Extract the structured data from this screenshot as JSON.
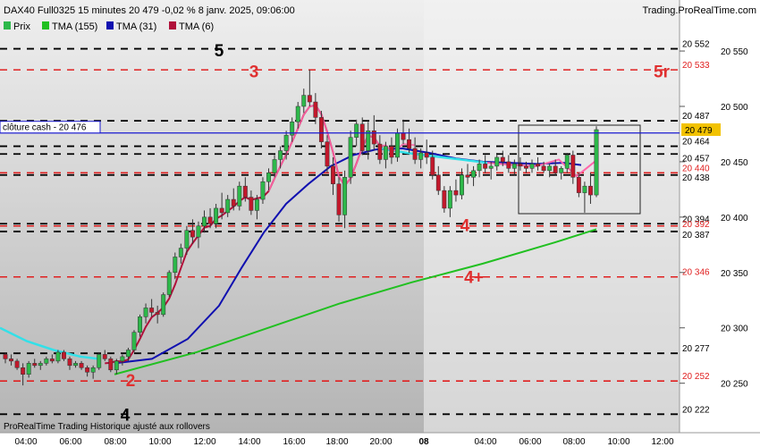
{
  "header": {
    "title": "DAX40 Full0325 15 minutes 20 479 -0,02 % 8 janv. 2025, 09:06:00",
    "site": "Trading.ProRealTime.com"
  },
  "legend": [
    {
      "label": "Prix",
      "color": "#2db84a"
    },
    {
      "label": "TMA (155)",
      "color": "#21c021"
    },
    {
      "label": "TMA (31)",
      "color": "#1010b0"
    },
    {
      "label": "TMA (6)",
      "color": "#b0103a"
    }
  ],
  "footer": "ProRealTime Trading  Historique ajusté aux rollovers",
  "cash_close": {
    "label": "clôture cash -  20 476",
    "value": 20476,
    "color": "#1a1ad0"
  },
  "last_price": {
    "label": "20 479",
    "value": 20479,
    "color": "#f2c200"
  },
  "colors": {
    "up": "#2db84a",
    "down": "#c2182b",
    "black_level": "#000000",
    "red_level": "#e02020",
    "cyan_tma": "#33e0e8",
    "pink_tma": "#ff66aa"
  },
  "chart_data": {
    "type": "candlestick",
    "ylim": [
      20215,
      20567
    ],
    "y_ticks": [
      20250,
      20300,
      20350,
      20400,
      20450,
      20500,
      20550
    ],
    "y_tick_labels": [
      "20 250",
      "20 300",
      "20 350",
      "20 400",
      "20 450",
      "20 500",
      "20 550"
    ],
    "x_tick_labels": [
      "04:00",
      "06:00",
      "08:00",
      "10:00",
      "12:00",
      "14:00",
      "16:00",
      "18:00",
      "20:00",
      "08",
      "04:00",
      "06:00",
      "08:00",
      "10:00",
      "12:00"
    ],
    "levels": [
      {
        "value": 20552,
        "label": "20 552",
        "style": "black"
      },
      {
        "value": 20533,
        "label": "20 533",
        "style": "red"
      },
      {
        "value": 20487,
        "label": "20 487",
        "style": "black"
      },
      {
        "value": 20464,
        "label": "20 464",
        "style": "black"
      },
      {
        "value": 20457,
        "label": "20 457",
        "style": "black"
      },
      {
        "value": 20440,
        "label": "20 440",
        "style": "red"
      },
      {
        "value": 20438,
        "label": "20 438",
        "style": "black"
      },
      {
        "value": 20394,
        "label": "20 394",
        "style": "black"
      },
      {
        "value": 20392,
        "label": "20 392",
        "style": "red"
      },
      {
        "value": 20387,
        "label": "20 387",
        "style": "black"
      },
      {
        "value": 20346,
        "label": "20 346",
        "style": "red"
      },
      {
        "value": 20277,
        "label": "20 277",
        "style": "black"
      },
      {
        "value": 20252,
        "label": "20 252",
        "style": "red"
      },
      {
        "value": 20222,
        "label": "20 222",
        "style": "black"
      }
    ],
    "wave_labels": [
      {
        "text": "5",
        "value": 20551,
        "color": "#000000"
      },
      {
        "text": "3",
        "value": 20532,
        "color": "#e03030"
      },
      {
        "text": "5r",
        "value": 20532,
        "color": "#e03030"
      },
      {
        "text": "4",
        "value": 20393,
        "color": "#e03030"
      },
      {
        "text": "4+",
        "value": 20346,
        "color": "#e03030"
      },
      {
        "text": "2",
        "value": 20253,
        "color": "#e03030"
      },
      {
        "text": "4",
        "value": 20222,
        "color": "#000000"
      }
    ],
    "candles": [
      [
        20276,
        20278,
        20268,
        20272
      ],
      [
        20272,
        20276,
        20266,
        20270
      ],
      [
        20270,
        20272,
        20262,
        20264
      ],
      [
        20264,
        20268,
        20248,
        20258
      ],
      [
        20258,
        20270,
        20255,
        20268
      ],
      [
        20268,
        20272,
        20264,
        20266
      ],
      [
        20266,
        20270,
        20262,
        20268
      ],
      [
        20268,
        20274,
        20266,
        20272
      ],
      [
        20272,
        20276,
        20268,
        20270
      ],
      [
        20270,
        20280,
        20268,
        20278
      ],
      [
        20278,
        20280,
        20270,
        20272
      ],
      [
        20272,
        20274,
        20262,
        20266
      ],
      [
        20266,
        20270,
        20264,
        20268
      ],
      [
        20268,
        20270,
        20262,
        20264
      ],
      [
        20264,
        20266,
        20256,
        20260
      ],
      [
        20260,
        20266,
        20254,
        20264
      ],
      [
        20264,
        20278,
        20262,
        20276
      ],
      [
        20276,
        20280,
        20270,
        20272
      ],
      [
        20272,
        20274,
        20260,
        20262
      ],
      [
        20262,
        20272,
        20258,
        20270
      ],
      [
        20270,
        20276,
        20266,
        20274
      ],
      [
        20274,
        20282,
        20270,
        20280
      ],
      [
        20280,
        20298,
        20278,
        20296
      ],
      [
        20296,
        20312,
        20292,
        20310
      ],
      [
        20310,
        20322,
        20304,
        20318
      ],
      [
        20318,
        20326,
        20310,
        20314
      ],
      [
        20314,
        20320,
        20304,
        20312
      ],
      [
        20312,
        20332,
        20310,
        20330
      ],
      [
        20330,
        20352,
        20328,
        20350
      ],
      [
        20350,
        20368,
        20344,
        20364
      ],
      [
        20364,
        20376,
        20358,
        20372
      ],
      [
        20372,
        20392,
        20366,
        20388
      ],
      [
        20388,
        20398,
        20376,
        20382
      ],
      [
        20382,
        20396,
        20372,
        20392
      ],
      [
        20392,
        20406,
        20386,
        20400
      ],
      [
        20400,
        20408,
        20390,
        20394
      ],
      [
        20394,
        20412,
        20390,
        20408
      ],
      [
        20408,
        20422,
        20398,
        20404
      ],
      [
        20404,
        20420,
        20400,
        20416
      ],
      [
        20416,
        20426,
        20406,
        20410
      ],
      [
        20410,
        20432,
        20406,
        20428
      ],
      [
        20428,
        20436,
        20414,
        20418
      ],
      [
        20418,
        20424,
        20402,
        20406
      ],
      [
        20406,
        20420,
        20398,
        20416
      ],
      [
        20416,
        20436,
        20412,
        20432
      ],
      [
        20432,
        20444,
        20424,
        20440
      ],
      [
        20440,
        20456,
        20436,
        20452
      ],
      [
        20452,
        20464,
        20444,
        20460
      ],
      [
        20460,
        20478,
        20452,
        20474
      ],
      [
        20474,
        20490,
        20468,
        20486
      ],
      [
        20486,
        20504,
        20480,
        20500
      ],
      [
        20500,
        20516,
        20494,
        20510
      ],
      [
        20510,
        20533,
        20500,
        20504
      ],
      [
        20504,
        20512,
        20484,
        20490
      ],
      [
        20490,
        20496,
        20462,
        20468
      ],
      [
        20468,
        20474,
        20440,
        20446
      ],
      [
        20446,
        20454,
        20420,
        20430
      ],
      [
        20430,
        20436,
        20396,
        20402
      ],
      [
        20402,
        20442,
        20390,
        20436
      ],
      [
        20436,
        20478,
        20430,
        20472
      ],
      [
        20472,
        20488,
        20464,
        20484
      ],
      [
        20484,
        20490,
        20456,
        20460
      ],
      [
        20460,
        20486,
        20452,
        20478
      ],
      [
        20478,
        20492,
        20460,
        20466
      ],
      [
        20466,
        20474,
        20448,
        20452
      ],
      [
        20452,
        20468,
        20444,
        20464
      ],
      [
        20464,
        20472,
        20448,
        20454
      ],
      [
        20454,
        20480,
        20450,
        20476
      ],
      [
        20476,
        20488,
        20466,
        20470
      ],
      [
        20470,
        20480,
        20458,
        20462
      ],
      [
        20462,
        20472,
        20448,
        20452
      ],
      [
        20452,
        20462,
        20444,
        20458
      ],
      [
        20458,
        20470,
        20448,
        20454
      ],
      [
        20454,
        20460,
        20434,
        20438
      ],
      [
        20438,
        20446,
        20420,
        20424
      ],
      [
        20424,
        20428,
        20404,
        20408
      ],
      [
        20408,
        20428,
        20400,
        20424
      ],
      [
        20424,
        20434,
        20414,
        20420
      ],
      [
        20420,
        20444,
        20416,
        20438
      ],
      [
        20438,
        20448,
        20430,
        20436
      ],
      [
        20436,
        20446,
        20428,
        20442
      ],
      [
        20442,
        20452,
        20436,
        20448
      ],
      [
        20448,
        20456,
        20440,
        20444
      ],
      [
        20444,
        20450,
        20434,
        20446
      ],
      [
        20446,
        20458,
        20442,
        20454
      ],
      [
        20454,
        20460,
        20446,
        20450
      ],
      [
        20450,
        20456,
        20440,
        20444
      ],
      [
        20444,
        20452,
        20438,
        20448
      ],
      [
        20448,
        20454,
        20442,
        20446
      ],
      [
        20446,
        20450,
        20440,
        20444
      ],
      [
        20444,
        20452,
        20440,
        20448
      ],
      [
        20448,
        20454,
        20442,
        20446
      ],
      [
        20446,
        20450,
        20440,
        20442
      ],
      [
        20442,
        20448,
        20436,
        20446
      ],
      [
        20446,
        20452,
        20438,
        20440
      ],
      [
        20440,
        20446,
        20434,
        20444
      ],
      [
        20444,
        20458,
        20440,
        20456
      ],
      [
        20456,
        20460,
        20430,
        20436
      ],
      [
        20436,
        20440,
        20418,
        20422
      ],
      [
        20422,
        20432,
        20404,
        20428
      ],
      [
        20428,
        20440,
        20412,
        20420
      ],
      [
        20420,
        20482,
        20418,
        20479
      ]
    ],
    "tma155": [
      [
        128,
        20258
      ],
      [
        220,
        20278
      ],
      [
        300,
        20300
      ],
      [
        380,
        20322
      ],
      [
        460,
        20341
      ],
      [
        540,
        20358
      ],
      [
        620,
        20377
      ],
      [
        667,
        20389
      ]
    ],
    "tma31": [
      [
        128,
        20268
      ],
      [
        170,
        20272
      ],
      [
        210,
        20290
      ],
      [
        245,
        20320
      ],
      [
        270,
        20354
      ],
      [
        295,
        20386
      ],
      [
        320,
        20412
      ],
      [
        345,
        20430
      ],
      [
        370,
        20446
      ],
      [
        395,
        20456
      ],
      [
        420,
        20461
      ],
      [
        450,
        20462
      ],
      [
        480,
        20458
      ],
      [
        510,
        20453
      ],
      [
        540,
        20450
      ],
      [
        570,
        20449
      ],
      [
        600,
        20448
      ],
      [
        630,
        20449
      ],
      [
        650,
        20447
      ]
    ],
    "tma6_cyan": [
      [
        0,
        20300
      ],
      [
        30,
        20288
      ],
      [
        60,
        20280
      ],
      [
        90,
        20274
      ],
      [
        110,
        20272
      ]
    ],
    "tma6_cyan_late": [
      [
        425,
        20462
      ],
      [
        455,
        20458
      ],
      [
        485,
        20455
      ],
      [
        515,
        20452
      ],
      [
        545,
        20449
      ]
    ],
    "tma6_late": [
      [
        545,
        20449
      ],
      [
        575,
        20447
      ],
      [
        600,
        20446
      ],
      [
        625,
        20452
      ],
      [
        645,
        20437
      ],
      [
        665,
        20450
      ]
    ]
  }
}
